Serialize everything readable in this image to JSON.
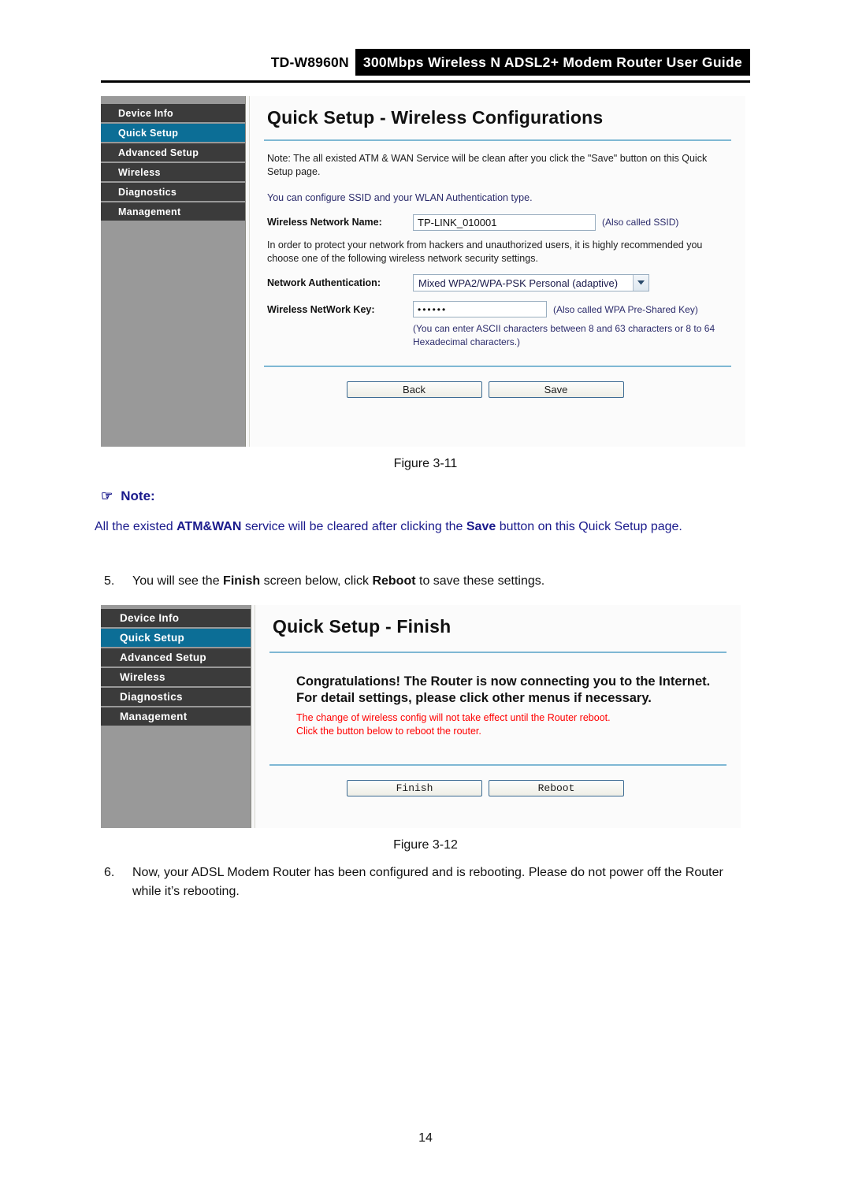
{
  "header": {
    "model": "TD-W8960N",
    "band_title": "300Mbps Wireless N ADSL2+ Modem Router User Guide"
  },
  "figure_3_11": {
    "caption": "Figure 3-11",
    "sidebar": [
      {
        "label": "Device Info",
        "active": false
      },
      {
        "label": "Quick Setup",
        "active": true
      },
      {
        "label": "Advanced Setup",
        "active": false
      },
      {
        "label": "Wireless",
        "active": false
      },
      {
        "label": "Diagnostics",
        "active": false
      },
      {
        "label": "Management",
        "active": false
      }
    ],
    "title": "Quick Setup - Wireless Configurations",
    "note": "Note: The all existed ATM & WAN Service will be clean after you click the \"Save\" button on this Quick Setup page.",
    "subtitle": "You can configure SSID and your WLAN Authentication type.",
    "ssid_label": "Wireless Network Name:",
    "ssid_value": "TP-LINK_010001",
    "ssid_hint": "(Also called SSID)",
    "security_para": "In order to protect your network from hackers and unauthorized users, it is highly recommended you choose one of the following wireless network security settings.",
    "auth_label": "Network Authentication:",
    "auth_value": "Mixed WPA2/WPA-PSK Personal (adaptive)",
    "key_label": "Wireless NetWork Key:",
    "key_value": "••••••",
    "key_hint": "(Also called WPA Pre-Shared Key)",
    "key_note": "(You can enter ASCII characters between 8 and 63 characters or 8 to 64 Hexadecimal characters.)",
    "back_button": "Back",
    "save_button": "Save"
  },
  "note_block": {
    "hand_icon": "☞",
    "heading": "Note:",
    "text_1": "All the existed ",
    "bold_1": "ATM&WAN",
    "text_2": " service will be cleared after clicking the ",
    "bold_2": "Save",
    "text_3": " button on this Quick Setup page."
  },
  "step_5": {
    "number": "5.",
    "text_1": "You will see the ",
    "bold_1": "Finish",
    "text_2": " screen below, click ",
    "bold_2": "Reboot",
    "text_3": " to save these settings."
  },
  "figure_3_12": {
    "caption": "Figure 3-12",
    "sidebar": [
      {
        "label": "Device Info",
        "active": false
      },
      {
        "label": "Quick Setup",
        "active": true
      },
      {
        "label": "Advanced Setup",
        "active": false
      },
      {
        "label": "Wireless",
        "active": false
      },
      {
        "label": "Diagnostics",
        "active": false
      },
      {
        "label": "Management",
        "active": false
      }
    ],
    "title": "Quick Setup - Finish",
    "congrats_line_1": "Congratulations! The Router is now connecting you to the Internet.",
    "congrats_line_2": "For detail settings, please click other menus if necessary.",
    "red_line_1": "The change of wireless config will not take effect until the Router reboot.",
    "red_line_2": "Click the button below to reboot the router.",
    "finish_button": "Finish",
    "reboot_button": "Reboot"
  },
  "step_6": {
    "number": "6.",
    "text": "Now, your ADSL Modem Router has been configured and is rebooting. Please do not power off the Router while it’s rebooting."
  },
  "page_number": "14",
  "colors": {
    "accent_teal": "#0c6e96",
    "divider_blue": "#7fb8d4",
    "nav_gray": "#3b3b3b",
    "sidebar_bg": "#999999",
    "note_navy": "#1a1a8c",
    "warning_red": "#ff0000"
  }
}
